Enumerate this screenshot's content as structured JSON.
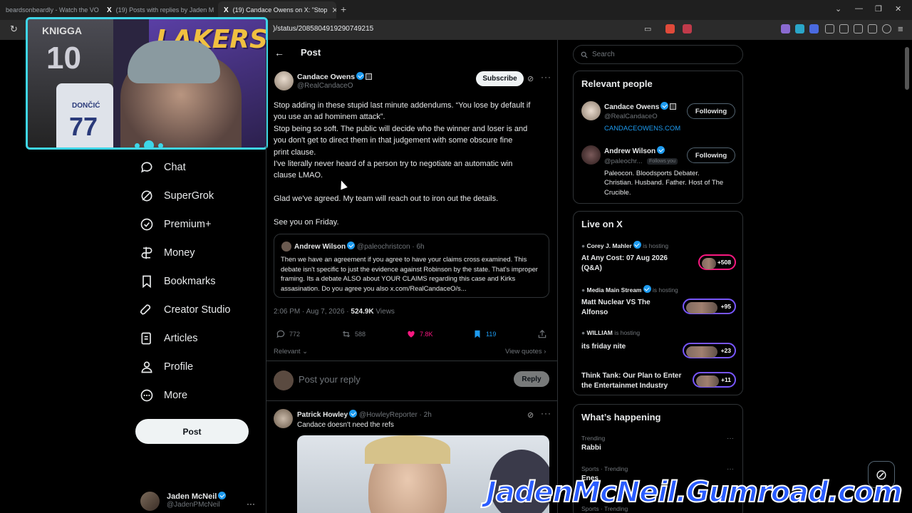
{
  "browser": {
    "tabs": [
      {
        "title": "beardsonbeardly - Watch the VO"
      },
      {
        "title": "(19) Posts with replies by Jaden M"
      },
      {
        "title": "(19) Candace Owens on X: \"Stop"
      }
    ],
    "url": ")/status/2085804919290749215"
  },
  "nav": {
    "items": [
      "Chat",
      "SuperGrok",
      "Premium+",
      "Money",
      "Bookmarks",
      "Creator Studio",
      "Articles",
      "Profile",
      "More"
    ],
    "post_label": "Post",
    "account": {
      "name": "Jaden McNeil",
      "handle": "@JadenPMcNeil"
    }
  },
  "webcam": {
    "jersey_text": "KNIGGA",
    "jersey_number": "10",
    "jersey2_text": "DONČIĆ",
    "jersey2_number": "77",
    "banner": "LAKERS"
  },
  "post": {
    "header_title": "Post",
    "author": {
      "name": "Candace Owens",
      "handle": "@RealCandaceO"
    },
    "subscribe_label": "Subscribe",
    "lines": [
      "Stop adding in these stupid last minute addendums. “You lose by default if",
      "you use an ad hominem attack”.",
      "Stop being so soft. The public will decide who the winner and loser is and",
      "you don't get to direct them in that judgement with some obscure fine",
      "print clause.",
      "I've literally never heard of a person try to negotiate an automatic win",
      "clause LMAO.",
      "",
      "Glad we've agreed. My team will reach out to iron out the details.",
      "",
      "See you on Friday."
    ],
    "quote": {
      "name": "Andrew Wilson",
      "handle": "@paleochristcon · 6h",
      "text": "Then we have an agreement if you agree to have your claims cross examined. This debate isn't specific to just the evidence against Robinson by the state. That's improper framing. Its a debate ALSO about YOUR CLAIMS regarding this case and Kirks assasination. Do you agree you also x.com/RealCandaceO/s..."
    },
    "timestamp": "2:06 PM · Aug 7, 2026 · ",
    "views": "524.9K",
    "views_label": " Views",
    "stats": {
      "replies": "772",
      "reposts": "588",
      "likes": "7.8K",
      "bookmarks": "119"
    },
    "relevant_label": "Relevant",
    "view_quotes_label": "View quotes"
  },
  "reply_box": {
    "placeholder": "Post your reply",
    "button": "Reply"
  },
  "reply": {
    "name": "Patrick Howley",
    "handle": "@HowleyReporter · 2h",
    "text": "Candace doesn't need the refs"
  },
  "sidebar": {
    "search_placeholder": "Search",
    "relevant_title": "Relevant people",
    "people": [
      {
        "name": "Candace Owens",
        "handle": "@RealCandaceO",
        "link": "CANDACEOWENS.COM",
        "button": "Following"
      },
      {
        "name": "Andrew Wilson",
        "handle": "@paleochr...",
        "follows_you": "Follows you",
        "bio": [
          "Paleocon. Bloodsports Debater.",
          "Christian. Husband. Father. Host of The",
          "Crucible."
        ],
        "button": "Following"
      }
    ],
    "live_title": "Live on X",
    "live": [
      {
        "host": "Corey J. Mahler",
        "status": " is hosting",
        "title": [
          "At Any Cost: 07 Aug 2026",
          "(Q&A)"
        ],
        "count": "+508",
        "color": "#f91880"
      },
      {
        "host": "Media Main Stream",
        "status": " is hosting",
        "title": [
          "Matt Nuclear VS The",
          "Alfonso"
        ],
        "count": "+95",
        "color": "#7856ff"
      },
      {
        "host": "WILLIAM",
        "status": " is hosting",
        "title": [
          "its friday nite"
        ],
        "count": "+23",
        "color": "#7856ff"
      },
      {
        "host": "",
        "status": "",
        "title": [
          "Think Tank: Our Plan to Enter",
          "the Entertainmet Industry"
        ],
        "count": "+11",
        "color": "#7856ff"
      }
    ],
    "happening_title": "What’s happening",
    "trends": [
      {
        "category": "Trending",
        "name": "Rabbi"
      },
      {
        "category": "Sports · Trending",
        "name": "Enes"
      },
      {
        "category": "Sports · Trending",
        "name": ""
      }
    ]
  },
  "watermark": "JadenMcNeil.Gumroad.com",
  "colors": {
    "accent": "#1d9bf0",
    "like": "#f91880",
    "cam_border": "#3ed6e8"
  }
}
